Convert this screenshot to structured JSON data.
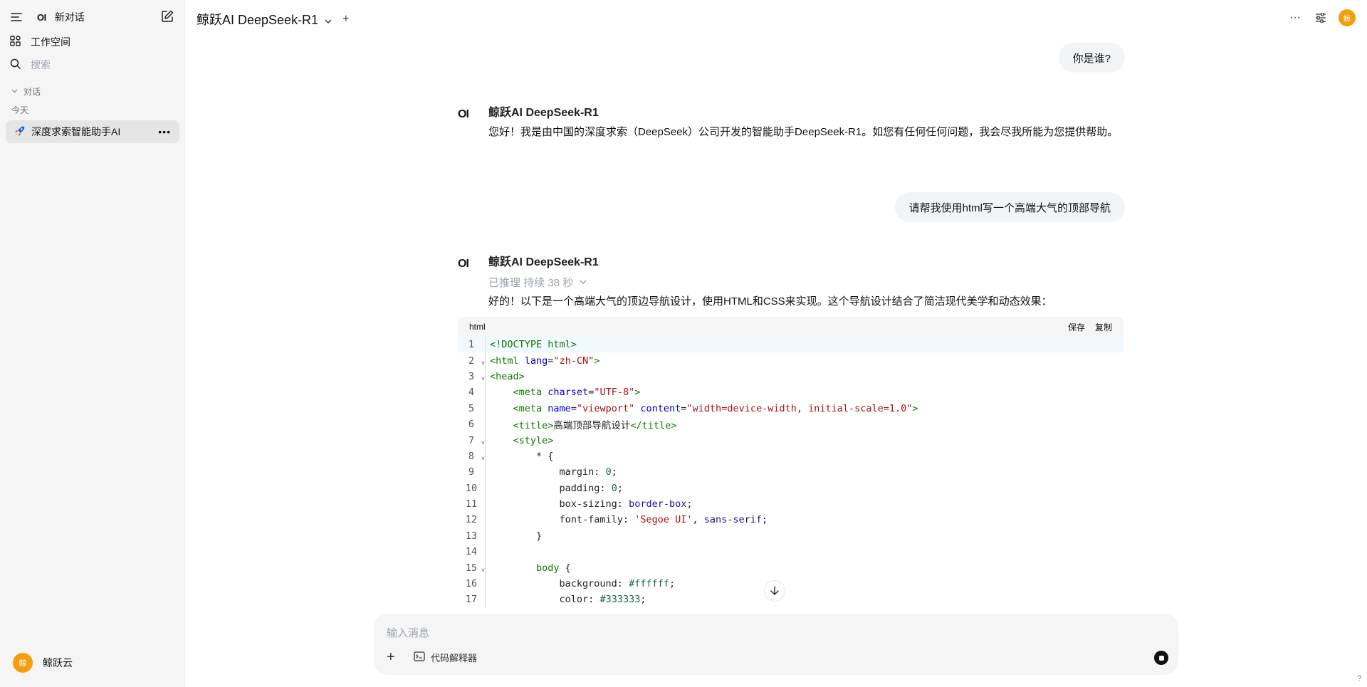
{
  "sidebar": {
    "logo": "OI",
    "new_chat": "新对话",
    "workspace": "工作空间",
    "search_placeholder": "搜索",
    "group_label": "对话",
    "today_label": "今天",
    "chat_item": "深度求索智能助手AI",
    "user_name": "鲸跃云",
    "user_avatar": "鲸"
  },
  "header": {
    "model_name": "鲸跃AI DeepSeek-R1",
    "avatar": "鲸"
  },
  "messages": {
    "user1": "你是谁?",
    "ai1_name": "鲸跃AI DeepSeek-R1",
    "ai1_text": "您好！我是由中国的深度求索（DeepSeek）公司开发的智能助手DeepSeek-R1。如您有任何任何问题，我会尽我所能为您提供帮助。",
    "user2": "请帮我使用html写一个高端大气的顶部导航",
    "ai2_name": "鲸跃AI DeepSeek-R1",
    "ai2_reason": "已推理 持续 38 秒",
    "ai2_text": "好的！以下是一个高端大气的顶边导航设计，使用HTML和CSS来实现。这个导航设计结合了简洁现代美学和动态效果："
  },
  "code_block": {
    "language": "html",
    "save_label": "保存",
    "copy_label": "复制"
  },
  "input": {
    "placeholder": "输入消息",
    "tool_label": "代码解释器"
  },
  "help_label": "?"
}
